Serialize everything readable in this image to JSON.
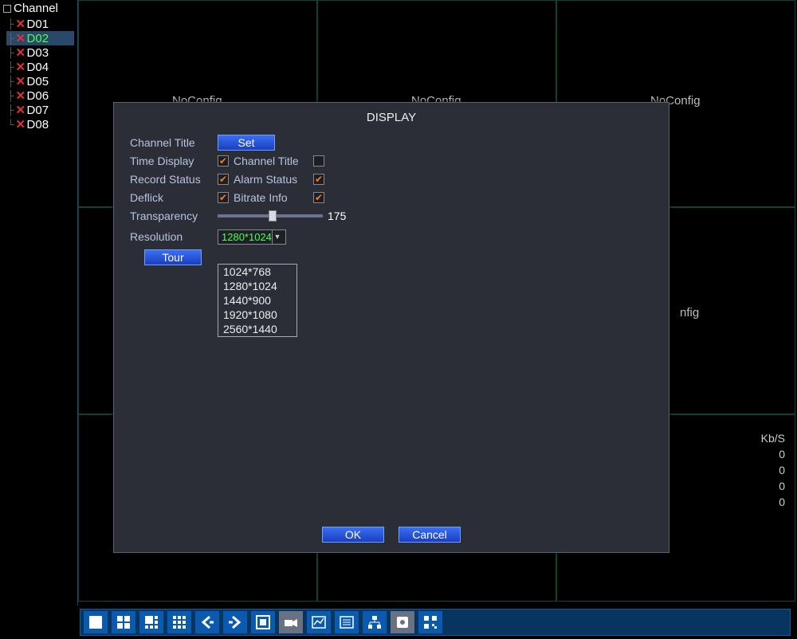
{
  "sidebar": {
    "header": "Channel",
    "items": [
      {
        "label": "D01",
        "selected": false
      },
      {
        "label": "D02",
        "selected": true
      },
      {
        "label": "D03",
        "selected": false
      },
      {
        "label": "D04",
        "selected": false
      },
      {
        "label": "D05",
        "selected": false
      },
      {
        "label": "D06",
        "selected": false
      },
      {
        "label": "D07",
        "selected": false
      },
      {
        "label": "D08",
        "selected": false
      }
    ]
  },
  "grid": {
    "noconfig_label": "NoConfig",
    "kbs_label": "Kb/S",
    "kbs_values": [
      "0",
      "0",
      "0",
      "0"
    ]
  },
  "dialog": {
    "title": "DISPLAY",
    "channel_title_label": "Channel Title",
    "set_btn": "Set",
    "time_display_label": "Time Display",
    "time_display_checked": true,
    "channel_title2_label": "Channel Title",
    "channel_title2_checked": false,
    "record_status_label": "Record Status",
    "record_status_checked": true,
    "alarm_status_label": "Alarm Status",
    "alarm_status_checked": true,
    "deflick_label": "Deflick",
    "deflick_checked": true,
    "bitrate_info_label": "Bitrate Info",
    "bitrate_info_checked": true,
    "transparency_label": "Transparency",
    "transparency_value": "175",
    "resolution_label": "Resolution",
    "resolution_selected": "1280*1024",
    "resolution_options": [
      "1024*768",
      "1280*1024",
      "1440*900",
      "1920*1080",
      "2560*1440"
    ],
    "tour_btn": "Tour",
    "ok_btn": "OK",
    "cancel_btn": "Cancel"
  },
  "toolbar": {
    "items": [
      {
        "name": "view-single-icon"
      },
      {
        "name": "view-quad-icon"
      },
      {
        "name": "view-six-icon"
      },
      {
        "name": "view-nine-icon"
      },
      {
        "name": "prev-icon"
      },
      {
        "name": "next-icon"
      },
      {
        "name": "fullscreen-icon"
      },
      {
        "name": "camera-icon"
      },
      {
        "name": "chart-icon"
      },
      {
        "name": "settings-icon"
      },
      {
        "name": "network-icon"
      },
      {
        "name": "disk-icon"
      },
      {
        "name": "qr-icon"
      }
    ]
  }
}
